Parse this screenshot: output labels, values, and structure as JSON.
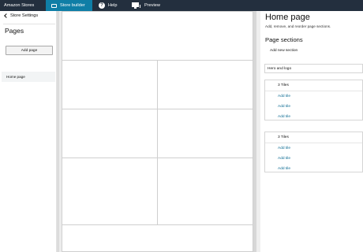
{
  "topbar": {
    "brand": "Amazon Stores",
    "tabs": [
      {
        "label": "Store builder",
        "icon": "store-icon",
        "active": true
      },
      {
        "label": "Help",
        "icon": "help-icon"
      },
      {
        "label": "Preview",
        "icon": "preview-icon"
      }
    ],
    "active_color": "#0f7ea6",
    "bar_color": "#232f3e"
  },
  "left_panel": {
    "back_label": "Store Settings",
    "title": "Pages",
    "add_page_label": "Add page",
    "pages": [
      {
        "label": "Home page",
        "selected": true
      }
    ]
  },
  "right_panel": {
    "title": "Home page",
    "subtitle": "Add, remove, and reorder page sections.",
    "sections_title": "Page sections",
    "add_section_label": "Add new section",
    "sections": [
      {
        "label": "Hero and logo"
      },
      {
        "label": "3 Tiles",
        "add_tile": [
          "Add tile",
          "Add tile",
          "Add tile"
        ]
      },
      {
        "label": "3 Tiles",
        "add_tile": [
          "Add tile",
          "Add tile",
          "Add tile"
        ]
      }
    ],
    "link_color": "#0b6a92"
  }
}
